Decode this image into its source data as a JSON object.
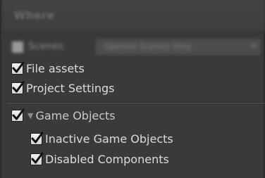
{
  "panel": {
    "title": "Where",
    "scenes_label": "Scenes",
    "scenes_dropdown": "Opened Scenes Only",
    "scenes_dropdown_arrow": "▾"
  },
  "options": {
    "file_assets": {
      "label": "File assets",
      "checked": true
    },
    "project_settings": {
      "label": "Project Settings",
      "checked": true
    },
    "game_objects": {
      "label": "Game Objects",
      "checked": true,
      "expanded": true,
      "foldout_glyph": "▼"
    },
    "inactive_game_objects": {
      "label": "Inactive Game Objects",
      "checked": true
    },
    "disabled_components": {
      "label": "Disabled Components",
      "checked": true
    }
  },
  "colors": {
    "background": "#3a3a3a",
    "checkbox": "#e6e6e6",
    "checkmark": "#111111",
    "text": "#dcdcdc"
  }
}
